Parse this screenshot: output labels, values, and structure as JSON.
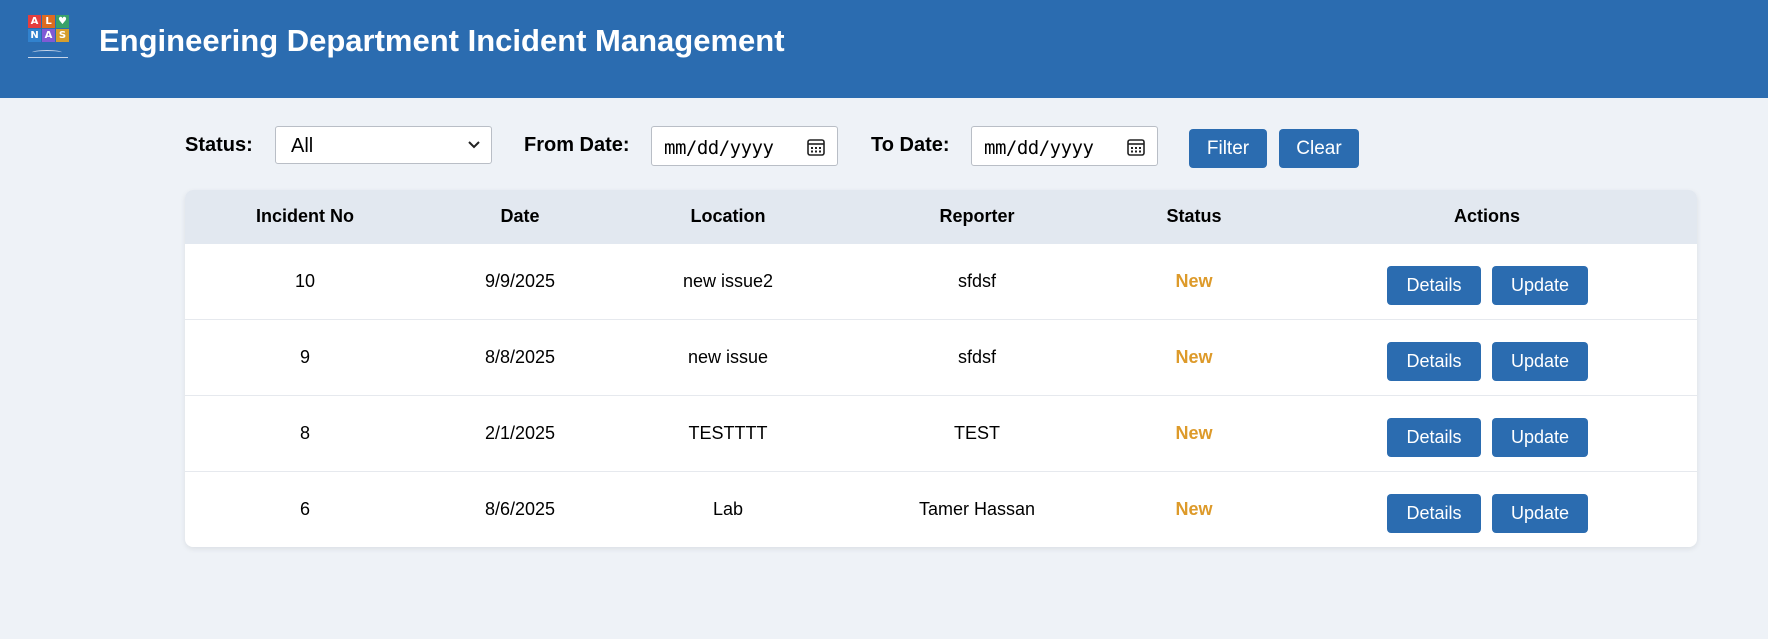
{
  "header": {
    "title": "Engineering Department Incident Management",
    "logo": {
      "letters": [
        "A",
        "L",
        "♥",
        "N",
        "A",
        "S"
      ],
      "colors": [
        "#e53e3e",
        "#dd6b20",
        "#38a169",
        "#3182ce",
        "#805ad5",
        "#d69e2e"
      ]
    }
  },
  "filters": {
    "status_label": "Status:",
    "status_value": "All",
    "from_label": "From Date:",
    "from_value": "mm/dd/yyyy",
    "to_label": "To Date:",
    "to_value": "mm/dd/yyyy",
    "filter_label": "Filter",
    "clear_label": "Clear"
  },
  "table": {
    "columns": [
      "Incident No",
      "Date",
      "Location",
      "Reporter",
      "Status",
      "Actions"
    ],
    "rows": [
      {
        "no": "10",
        "date": "9/9/2025",
        "location": "new issue2",
        "reporter": "sfdsf",
        "status": "New",
        "details": "Details",
        "update": "Update"
      },
      {
        "no": "9",
        "date": "8/8/2025",
        "location": "new issue",
        "reporter": "sfdsf",
        "status": "New",
        "details": "Details",
        "update": "Update"
      },
      {
        "no": "8",
        "date": "2/1/2025",
        "location": "TESTTTT",
        "reporter": "TEST",
        "status": "New",
        "details": "Details",
        "update": "Update"
      },
      {
        "no": "6",
        "date": "8/6/2025",
        "location": "Lab",
        "reporter": "Tamer Hassan",
        "status": "New",
        "details": "Details",
        "update": "Update"
      }
    ]
  },
  "colors": {
    "primary": "#2b6cb0",
    "status_new": "#dd9a2a",
    "page_bg": "#eef2f7",
    "table_header_bg": "#e2e8f0"
  }
}
